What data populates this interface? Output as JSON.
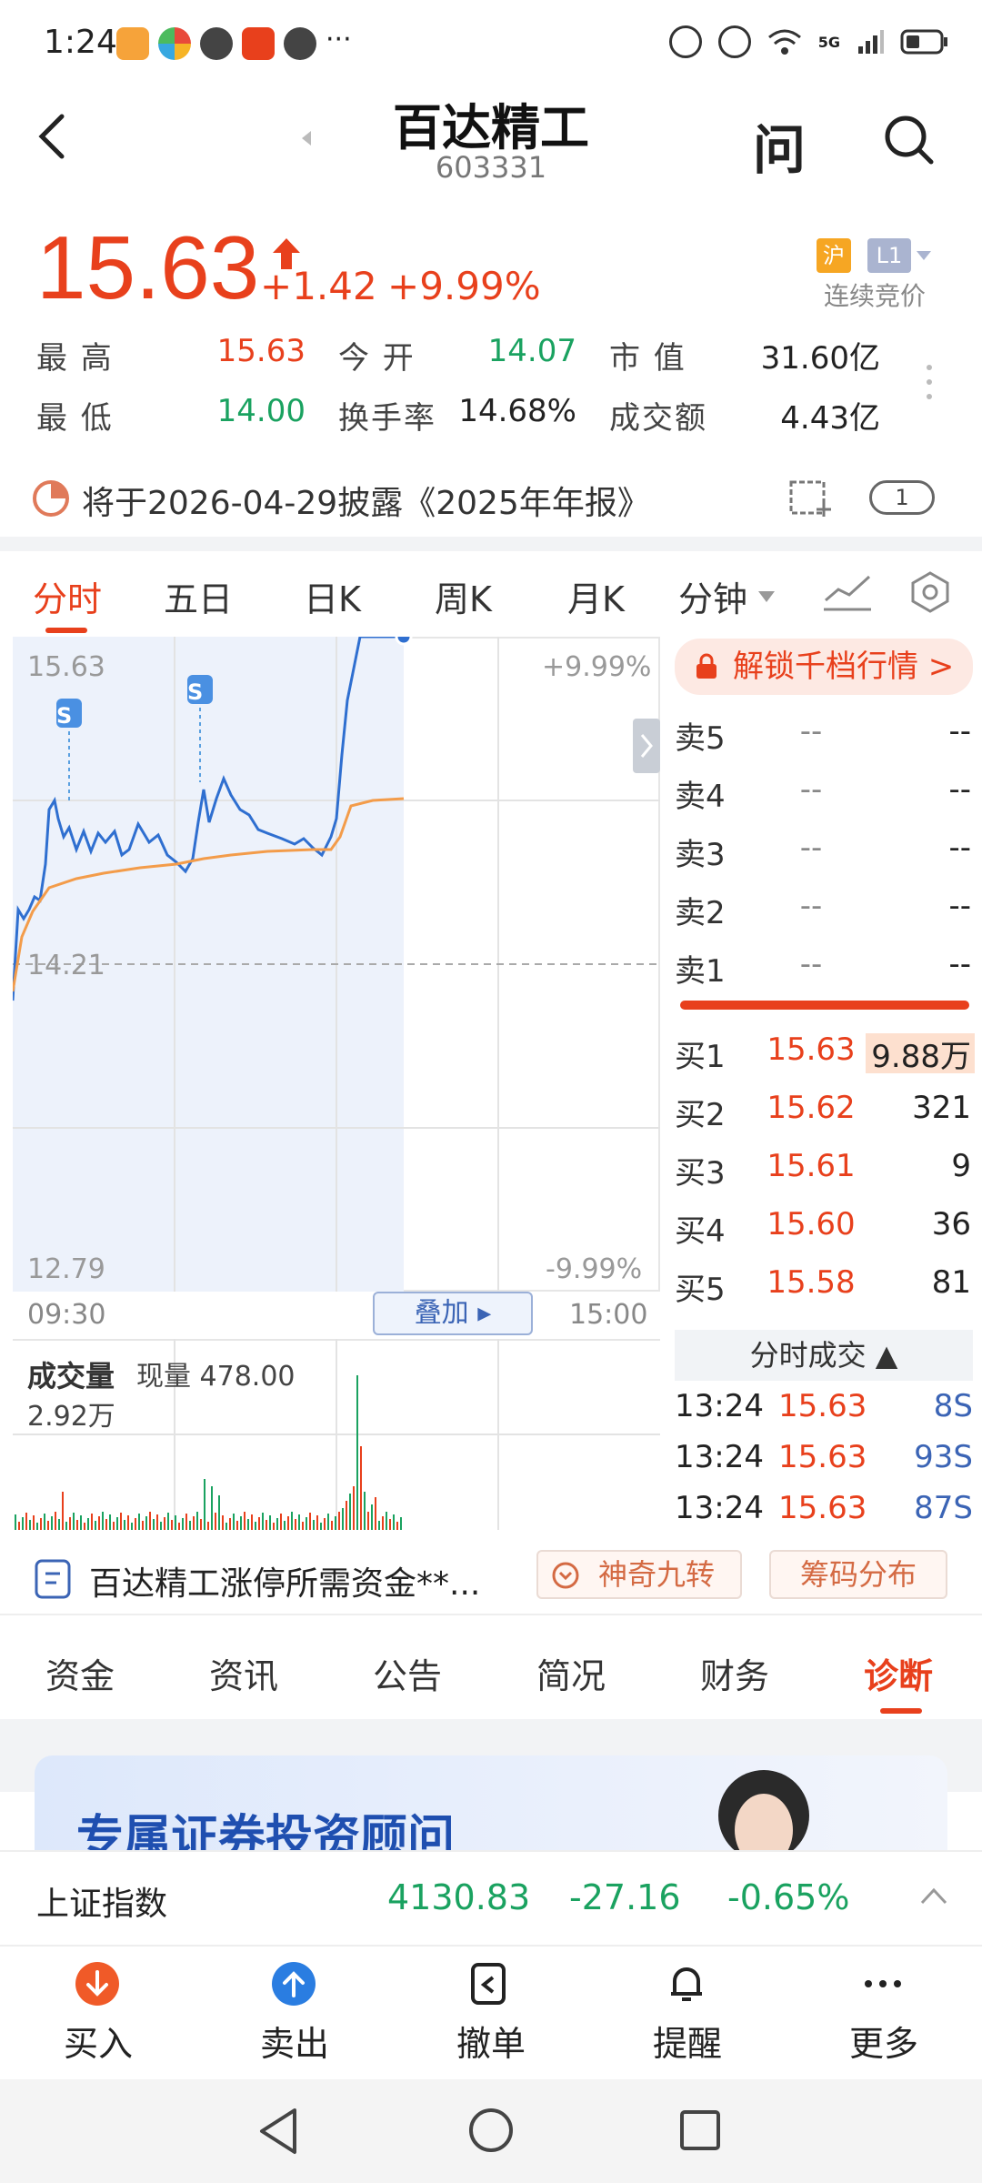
{
  "status_bar": {
    "time": "1:24",
    "dots": "···",
    "network": "5G"
  },
  "header": {
    "back_label": "<",
    "stock_name": "百达精工",
    "stock_code": "603331",
    "ask_label": "问"
  },
  "quote": {
    "price": "15.63",
    "change": "+1.42",
    "change_pct": "+9.99%",
    "exchange_tag": "沪",
    "level_tag": "L1",
    "mode": "连续竞价"
  },
  "stats": [
    {
      "label": "最 高",
      "value": "15.63",
      "color": "red"
    },
    {
      "label": "今 开",
      "value": "14.07",
      "color": "green"
    },
    {
      "label": "市 值",
      "value": "31.60亿",
      "color": "black"
    },
    {
      "label": "最 低",
      "value": "14.00",
      "color": "green"
    },
    {
      "label": "换手率",
      "value": "14.68%",
      "color": "black"
    },
    {
      "label": "成交额",
      "value": "4.43亿",
      "color": "black"
    }
  ],
  "announcement": {
    "text": "将于2026-04-29披露《2025年年报》",
    "badge": "1"
  },
  "chart_tabs": [
    "分时",
    "五日",
    "日K",
    "周K",
    "月K",
    "分钟"
  ],
  "chart_labels": {
    "top_price": "15.63",
    "top_pct": "+9.99%",
    "mid_price": "14.21",
    "bottom_price": "12.79",
    "bottom_pct": "-9.99%",
    "time_start": "09:30",
    "time_end": "15:00",
    "overlay": "叠加",
    "s_marker": "S"
  },
  "volume": {
    "title": "成交量",
    "current": "现量 478.00",
    "max": "2.92万"
  },
  "order_book": {
    "unlock_label": "解锁千档行情 >",
    "asks": [
      {
        "label": "卖5",
        "price": "--",
        "vol": "--"
      },
      {
        "label": "卖4",
        "price": "--",
        "vol": "--"
      },
      {
        "label": "卖3",
        "price": "--",
        "vol": "--"
      },
      {
        "label": "卖2",
        "price": "--",
        "vol": "--"
      },
      {
        "label": "卖1",
        "price": "--",
        "vol": "--"
      }
    ],
    "bids": [
      {
        "label": "买1",
        "price": "15.63",
        "vol": "9.88万"
      },
      {
        "label": "买2",
        "price": "15.62",
        "vol": "321"
      },
      {
        "label": "买3",
        "price": "15.61",
        "vol": "9"
      },
      {
        "label": "买4",
        "price": "15.60",
        "vol": "36"
      },
      {
        "label": "买5",
        "price": "15.58",
        "vol": "81"
      }
    ]
  },
  "ticks": {
    "header": "分时成交 ▲",
    "rows": [
      {
        "time": "13:24",
        "price": "15.63",
        "vol": "8S"
      },
      {
        "time": "13:24",
        "price": "15.63",
        "vol": "93S"
      },
      {
        "time": "13:24",
        "price": "15.63",
        "vol": "87S"
      }
    ]
  },
  "info_bar": {
    "text": "百达精工涨停所需资金**...",
    "nine_label": "神奇九转",
    "chips_label": "筹码分布"
  },
  "bottom_tabs": [
    "资金",
    "资讯",
    "公告",
    "简况",
    "财务",
    "诊断"
  ],
  "banner": {
    "text": "专属证券投资顾问"
  },
  "index": {
    "name": "上证指数",
    "value": "4130.83",
    "change": "-27.16",
    "change_pct": "-0.65%"
  },
  "actions": [
    "买入",
    "卖出",
    "撤单",
    "提醒",
    "更多"
  ],
  "colors": {
    "red": "#e8401c",
    "green": "#1aa260",
    "price_line": "#2f6fd0",
    "avg_line": "#f39c4a"
  }
}
